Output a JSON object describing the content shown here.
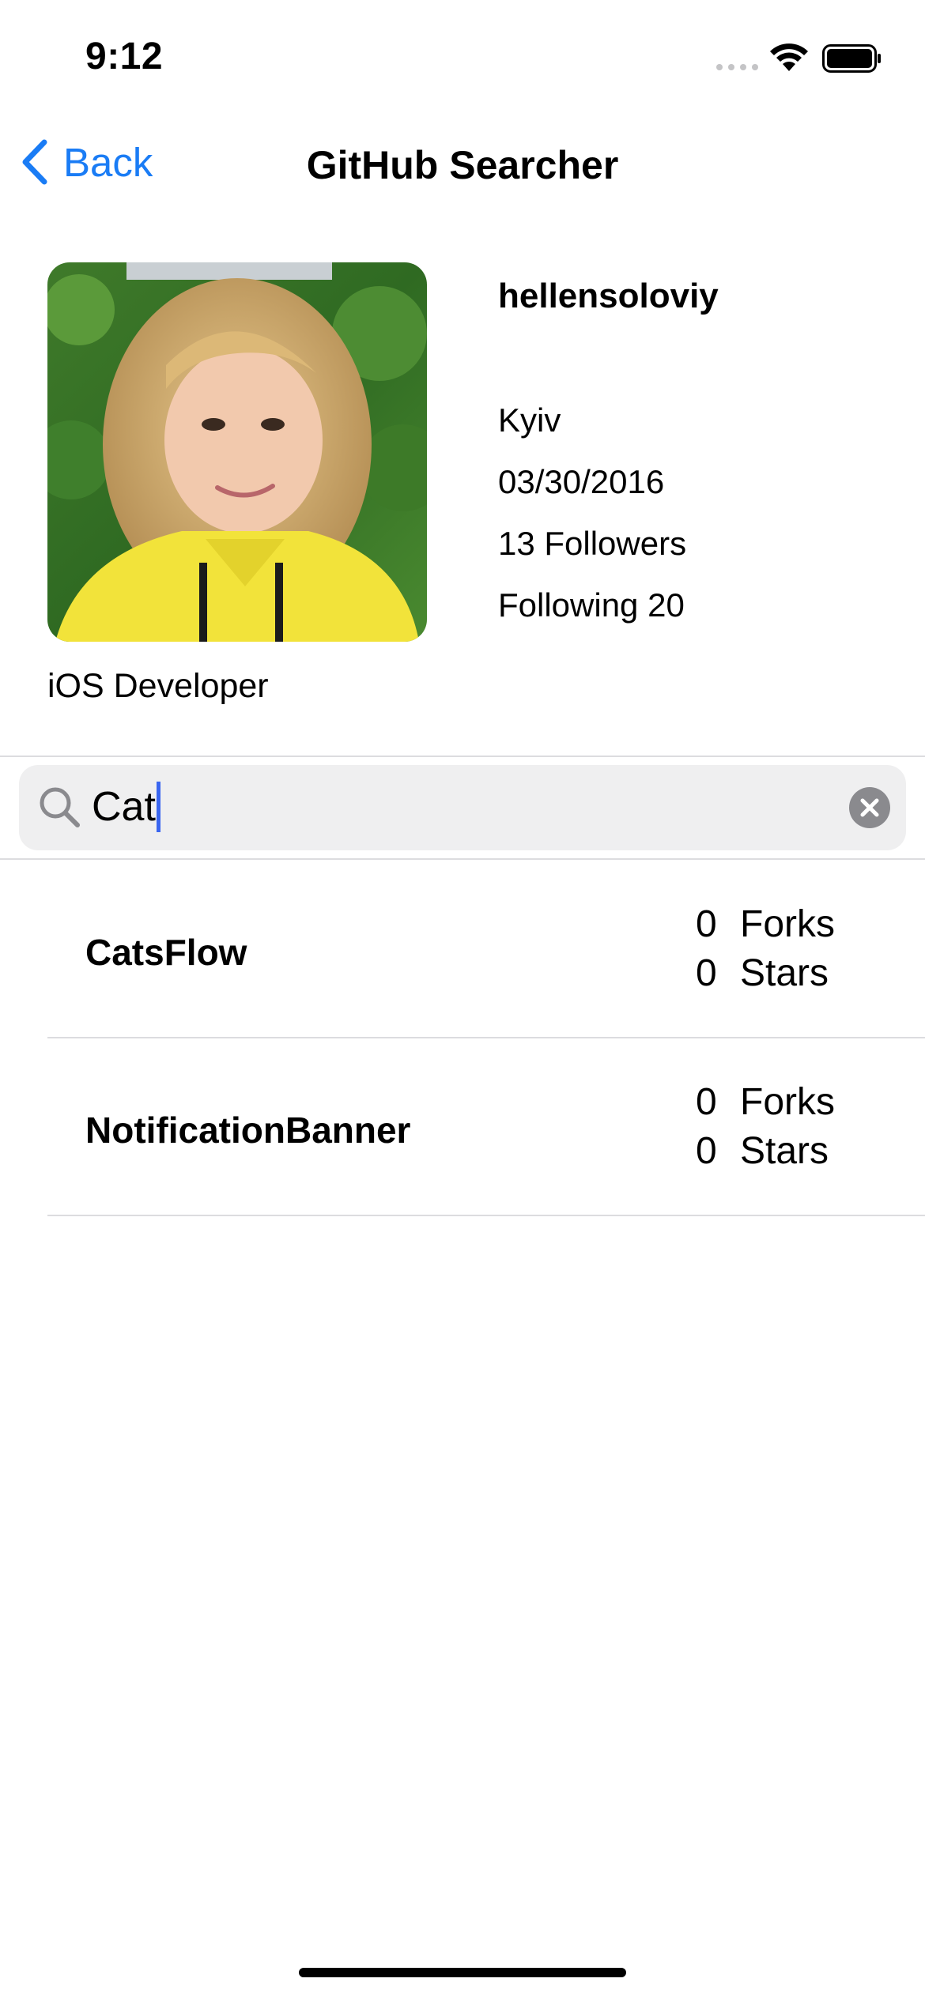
{
  "status_bar": {
    "time": "9:12",
    "icons": [
      "cellular-signal-icon",
      "wifi-icon",
      "battery-icon"
    ]
  },
  "nav": {
    "back_label": "Back",
    "title": "GitHub Searcher",
    "accent_color": "#1a7cf5"
  },
  "profile": {
    "username": "hellensoloviy",
    "location": "Kyiv",
    "join_date": "03/30/2016",
    "followers": "13 Followers",
    "following": "Following 20",
    "bio": "iOS Developer"
  },
  "search": {
    "value": "Cat",
    "icon": "search-icon",
    "clear_icon": "clear-icon"
  },
  "repos": [
    {
      "name": "CatsFlow",
      "forks_count": "0",
      "forks_label": "Forks",
      "stars_count": "0",
      "stars_label": "Stars"
    },
    {
      "name": "NotificationBanner",
      "forks_count": "0",
      "forks_label": "Forks",
      "stars_count": "0",
      "stars_label": "Stars"
    }
  ]
}
